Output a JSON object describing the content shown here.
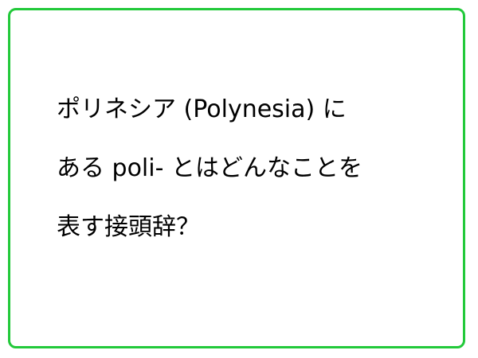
{
  "card": {
    "border_color": "#22c93a"
  },
  "question": {
    "lines": [
      "ポリネシア (Polynesia) に",
      "ある poli- とはどんなことを",
      "表す接頭辞？"
    ]
  }
}
